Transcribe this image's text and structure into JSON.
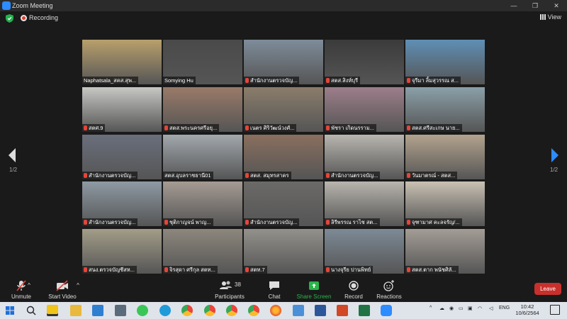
{
  "window": {
    "title": "Zoom Meeting",
    "minimize": "—",
    "maximize": "❐",
    "close": "✕"
  },
  "topbar": {
    "recording": "Recording",
    "view": "View"
  },
  "pager": {
    "left": "1/2",
    "right": "1/2"
  },
  "participants": [
    {
      "name": "Naphatsala_สคส.สุพ...",
      "active": true,
      "muted": false,
      "bg": "#b9a06c"
    },
    {
      "name": "Somying Hu",
      "muted": false,
      "bg": "#4a4a4a"
    },
    {
      "name": "สำนักงานตรวจบัญ...",
      "muted": true,
      "bg": "#7e8c9a"
    },
    {
      "name": "สตส.สิงห์บุรี",
      "muted": true,
      "bg": "#3b3b3b"
    },
    {
      "name": "จุรีมา ลิ้มสุวรรณ ส...",
      "muted": true,
      "bg": "#5f8fb5"
    },
    {
      "name": "สตศ.9",
      "muted": true,
      "bg": "#c7c7c4"
    },
    {
      "name": "สตส.พระนครศรีอยุ...",
      "muted": true,
      "bg": "#9a7a68"
    },
    {
      "name": "เนตร ศิริวัฒน์วงศ์...",
      "muted": true,
      "bg": "#8b7d6b"
    },
    {
      "name": "พัชรา เกิดนรราม...",
      "muted": true,
      "bg": "#9d7e8a"
    },
    {
      "name": "สตส.ศรีสะเกษ นาย...",
      "muted": true,
      "bg": "#8aa0a8"
    },
    {
      "name": "สำนักงานตรวจบัญ...",
      "muted": true,
      "bg": "#6a6f7c"
    },
    {
      "name": "สตส.อุบลราชธานี01",
      "muted": false,
      "bg": "#a2a8ad"
    },
    {
      "name": "สตส. สมุทรสาคร",
      "muted": true,
      "bg": "#8a6f5e"
    },
    {
      "name": "สำนักงานตรวจบัญ...",
      "muted": true,
      "bg": "#b9b6b0"
    },
    {
      "name": "วันมาตรณ์ - สตส...",
      "muted": true,
      "bg": "#b3a38e"
    },
    {
      "name": "สำนักงานตรวจบัญ...",
      "muted": true,
      "bg": "#8e9aa4"
    },
    {
      "name": "ชุติกาญจน์ พาญ...",
      "muted": true,
      "bg": "#a59b93"
    },
    {
      "name": "สำนักงานตรวจบัญ...",
      "muted": true,
      "bg": "#6b6a68"
    },
    {
      "name": "ลิรีพรรณ ราไช สต...",
      "muted": true,
      "bg": "#b8b5ae"
    },
    {
      "name": "จุฑามาศ คะลจรัญ/...",
      "muted": true,
      "bg": "#c9c1b3"
    },
    {
      "name": "สนง.ตรวจบัญชีสห...",
      "muted": true,
      "bg": "#a39d88"
    },
    {
      "name": "จิรสุดา ศรีกุล สตท...",
      "muted": true,
      "bg": "#8d877d"
    },
    {
      "name": "สตท.7",
      "muted": true,
      "bg": "#94918c"
    },
    {
      "name": "นางจุรีย ปานพิทย์",
      "muted": true,
      "bg": "#7d8a96"
    },
    {
      "name": "สตส.ตาก พนัชศิลั...",
      "muted": true,
      "bg": "#a49d96"
    }
  ],
  "toolbar": {
    "unmute": "Unmute",
    "start_video": "Start Video",
    "participants": "Participants",
    "participant_count": "38",
    "chat": "Chat",
    "share_screen": "Share Screen",
    "record": "Record",
    "reactions": "Reactions",
    "leave": "Leave"
  },
  "taskbar": {
    "language": "ENG",
    "time": "10:42",
    "date": "10/6/2564"
  },
  "colors": {
    "accent": "#2d8cff",
    "share": "#2ab44a",
    "leave": "#c9302c",
    "active_border": "#cde23a",
    "muted": "#e5453a"
  }
}
